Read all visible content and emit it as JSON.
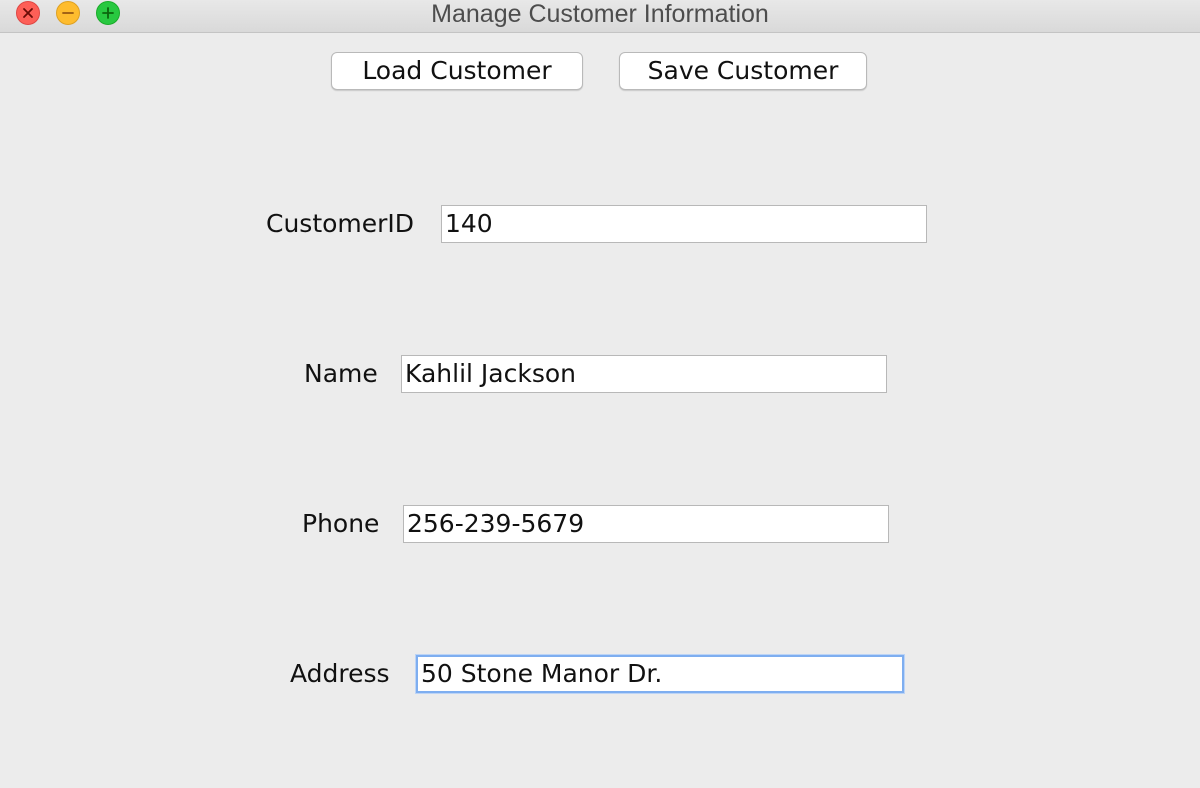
{
  "window": {
    "title": "Manage Customer Information"
  },
  "toolbar": {
    "load_label": "Load Customer",
    "save_label": "Save Customer"
  },
  "form": {
    "customer_id": {
      "label": "CustomerID",
      "value": "140"
    },
    "name": {
      "label": "Name",
      "value": "Kahlil Jackson"
    },
    "phone": {
      "label": "Phone",
      "value": "256-239-5679"
    },
    "address": {
      "label": "Address",
      "value": "50 Stone Manor Dr."
    }
  },
  "colors": {
    "background": "#ececec",
    "close": "#fd5f57",
    "minimize": "#febc2e",
    "maximize": "#28c840",
    "focus_ring": "#7eaef0"
  }
}
